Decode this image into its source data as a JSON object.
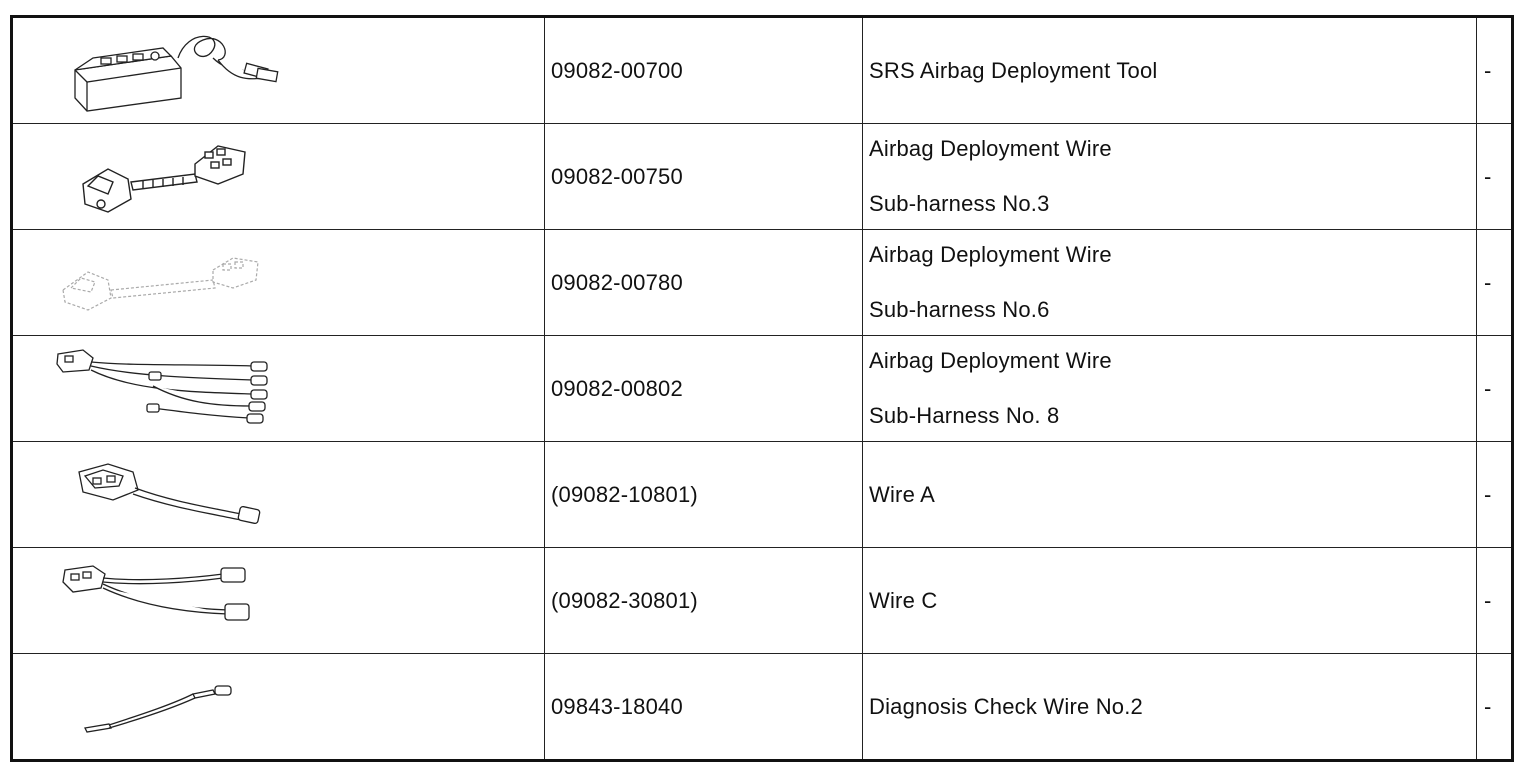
{
  "tools": [
    {
      "icon": "deployment-tool-box-icon",
      "part_number": "09082-00700",
      "name_lines": [
        "SRS Airbag Deployment Tool"
      ],
      "remark": "-"
    },
    {
      "icon": "sub-harness-connector-icon",
      "part_number": "09082-00750",
      "name_lines": [
        "Airbag Deployment Wire",
        "Sub-harness No.3"
      ],
      "remark": "-"
    },
    {
      "icon": "sub-harness-faded-icon",
      "part_number": "09082-00780",
      "name_lines": [
        "Airbag Deployment Wire",
        "Sub-harness No.6"
      ],
      "remark": "-"
    },
    {
      "icon": "multi-lead-harness-icon",
      "part_number": "09082-00802",
      "name_lines": [
        "Airbag Deployment Wire",
        "Sub-Harness No. 8"
      ],
      "remark": "-"
    },
    {
      "icon": "wire-a-icon",
      "part_number": "(09082-10801)",
      "name_lines": [
        "Wire A"
      ],
      "remark": "-"
    },
    {
      "icon": "wire-c-icon",
      "part_number": "(09082-30801)",
      "name_lines": [
        "Wire C"
      ],
      "remark": "-"
    },
    {
      "icon": "check-wire-icon",
      "part_number": "09843-18040",
      "name_lines": [
        "Diagnosis Check Wire No.2"
      ],
      "remark": "-"
    }
  ]
}
